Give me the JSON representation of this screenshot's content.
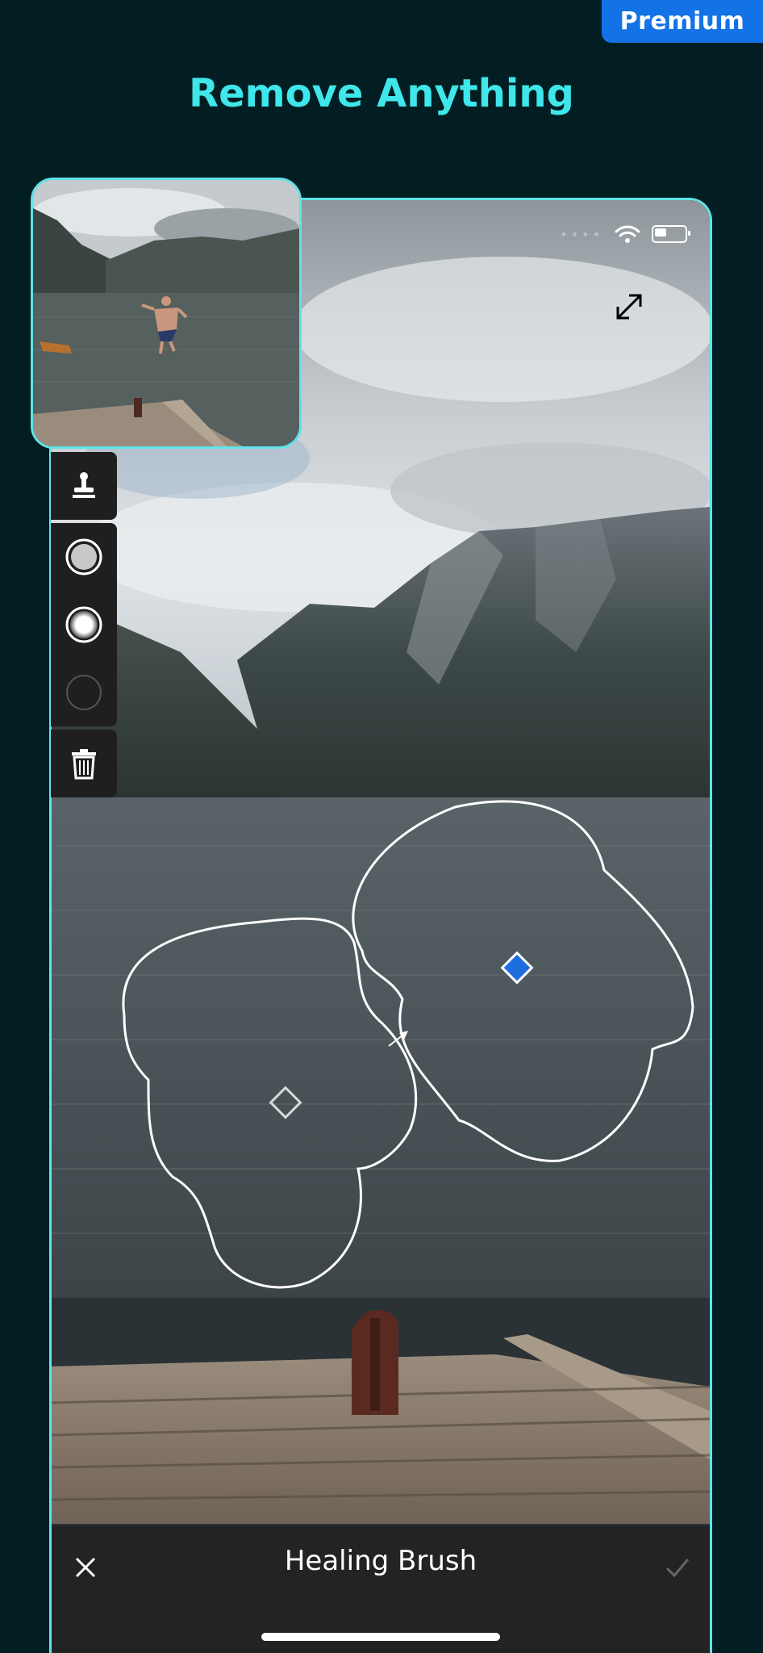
{
  "header": {
    "premium_label": "Premium",
    "title": "Remove Anything"
  },
  "icons": {
    "expand": "expand-arrows-icon",
    "stamp": "clone-stamp-icon",
    "brush_hard": "brush-hard-icon",
    "brush_soft": "brush-soft-icon",
    "brush_empty": "brush-empty-icon",
    "trash": "trash-icon",
    "close": "close-icon",
    "check": "check-icon",
    "wifi": "wifi-icon",
    "battery": "battery-icon"
  },
  "bottom_bar": {
    "tool_name": "Healing Brush"
  },
  "colors": {
    "background": "#021e22",
    "accent_title": "#3fe6ea",
    "premium_badge": "#1373e6",
    "frame_border": "#5fe3e8",
    "heal_source_marker": "#1e6ee0"
  }
}
